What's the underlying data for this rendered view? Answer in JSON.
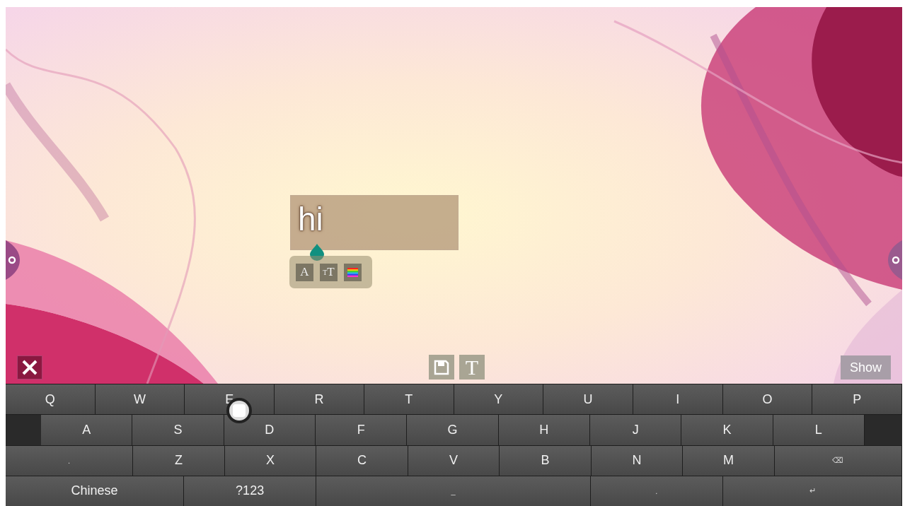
{
  "text_box": {
    "value": "hi"
  },
  "format_toolbar": [
    {
      "kind": "font",
      "glyph": "A"
    },
    {
      "kind": "size",
      "glyph": "T",
      "small_glyph": "T"
    },
    {
      "kind": "color"
    }
  ],
  "bottom_toolbar": {
    "text_tool_glyph": "T",
    "show_button": "Show"
  },
  "keyboard": {
    "rows": [
      {
        "keys": [
          {
            "kind": "letter",
            "label": "Q"
          },
          {
            "kind": "letter",
            "label": "W"
          },
          {
            "kind": "letter",
            "label": "E"
          },
          {
            "kind": "letter",
            "label": "R"
          },
          {
            "kind": "letter",
            "label": "T"
          },
          {
            "kind": "letter",
            "label": "Y"
          },
          {
            "kind": "letter",
            "label": "U"
          },
          {
            "kind": "letter",
            "label": "I"
          },
          {
            "kind": "letter",
            "label": "O"
          },
          {
            "kind": "letter",
            "label": "P"
          }
        ]
      },
      {
        "keys": [
          {
            "kind": "letter",
            "label": "A"
          },
          {
            "kind": "letter",
            "label": "S"
          },
          {
            "kind": "letter",
            "label": "D"
          },
          {
            "kind": "letter",
            "label": "F"
          },
          {
            "kind": "letter",
            "label": "G"
          },
          {
            "kind": "letter",
            "label": "H"
          },
          {
            "kind": "letter",
            "label": "J"
          },
          {
            "kind": "letter",
            "label": "K"
          },
          {
            "kind": "letter",
            "label": "L"
          }
        ]
      },
      {
        "keys": [
          {
            "kind": "shift",
            "label": "."
          },
          {
            "kind": "letter",
            "label": "Z"
          },
          {
            "kind": "letter",
            "label": "X"
          },
          {
            "kind": "letter",
            "label": "C"
          },
          {
            "kind": "letter",
            "label": "V"
          },
          {
            "kind": "letter",
            "label": "B"
          },
          {
            "kind": "letter",
            "label": "N"
          },
          {
            "kind": "letter",
            "label": "M"
          },
          {
            "kind": "delete",
            "label": "⌫"
          }
        ]
      },
      {
        "keys": [
          {
            "kind": "lang",
            "label": "Chinese"
          },
          {
            "kind": "symbols",
            "label": "?123"
          },
          {
            "kind": "space",
            "label": "_"
          },
          {
            "kind": "period",
            "label": "."
          },
          {
            "kind": "enter",
            "label": "↵"
          }
        ]
      }
    ]
  }
}
